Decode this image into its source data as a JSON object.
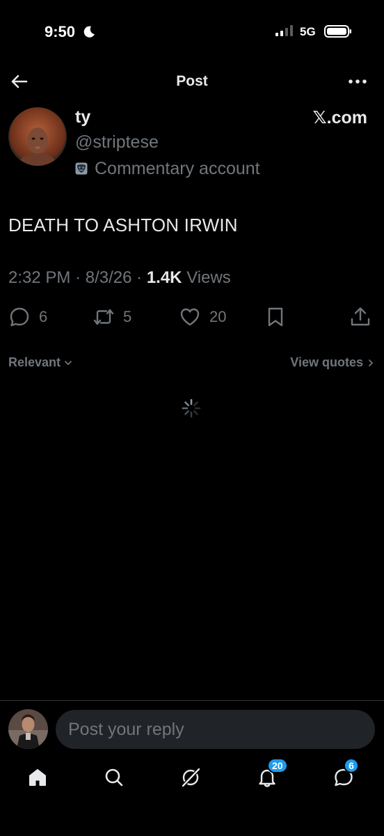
{
  "status_bar": {
    "time": "9:50",
    "network": "5G"
  },
  "header": {
    "title": "Post"
  },
  "post": {
    "author_name": "ty",
    "author_handle": "@striptese",
    "author_label": "Commentary account",
    "site_badge": "𝕏.com",
    "text": "DEATH TO ASHTON IRWIN",
    "time": "2:32 PM",
    "date": "8/3/26",
    "separator": "·",
    "views_count": "1.4K",
    "views_label": "Views",
    "replies": "6",
    "reposts": "5",
    "likes": "20"
  },
  "replies_filter": {
    "sort_label": "Relevant",
    "view_quotes_label": "View quotes"
  },
  "reply_box": {
    "placeholder": "Post your reply"
  },
  "tabbar": {
    "notifications_badge": "20",
    "messages_badge": "6"
  },
  "icons": {
    "back": "back-arrow-icon",
    "more": "more-icon",
    "reply": "reply-icon",
    "repost": "repost-icon",
    "like": "heart-icon",
    "bookmark": "bookmark-icon",
    "share": "share-icon",
    "home": "home-icon",
    "search": "search-icon",
    "grok": "grok-icon",
    "notifications": "bell-icon",
    "messages": "messages-icon"
  },
  "colors": {
    "background": "#000000",
    "text_primary": "#e7e9ea",
    "text_secondary": "#71767b",
    "accent": "#1d9bf0",
    "input_bg": "#202327"
  }
}
